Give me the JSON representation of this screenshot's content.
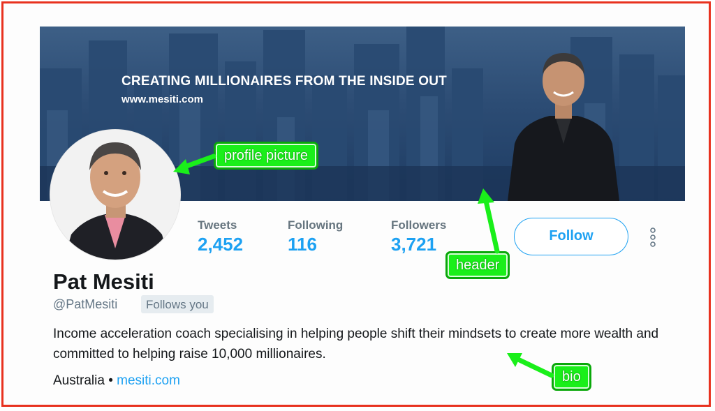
{
  "header": {
    "tagline": "CREATING MILLIONAIRES FROM THE INSIDE OUT",
    "website": "www.mesiti.com"
  },
  "stats": [
    {
      "label": "Tweets",
      "value": "2,452"
    },
    {
      "label": "Following",
      "value": "116"
    },
    {
      "label": "Followers",
      "value": "3,721"
    }
  ],
  "follow_button": "Follow",
  "profile": {
    "name": "Pat Mesiti",
    "handle": "@PatMesiti",
    "follows_you": "Follows you",
    "bio": "Income acceleration coach specialising in helping people shift their mindsets to create more wealth and committed to helping raise 10,000 millionaires.",
    "location": "Australia",
    "separator": " • ",
    "link": "mesiti.com"
  },
  "annotations": {
    "profile_picture": "profile picture",
    "header": "header",
    "bio": "bio"
  },
  "colors": {
    "accent": "#1da1f2",
    "annotation_green": "#1aef1a",
    "frame_red": "#e8321f"
  }
}
